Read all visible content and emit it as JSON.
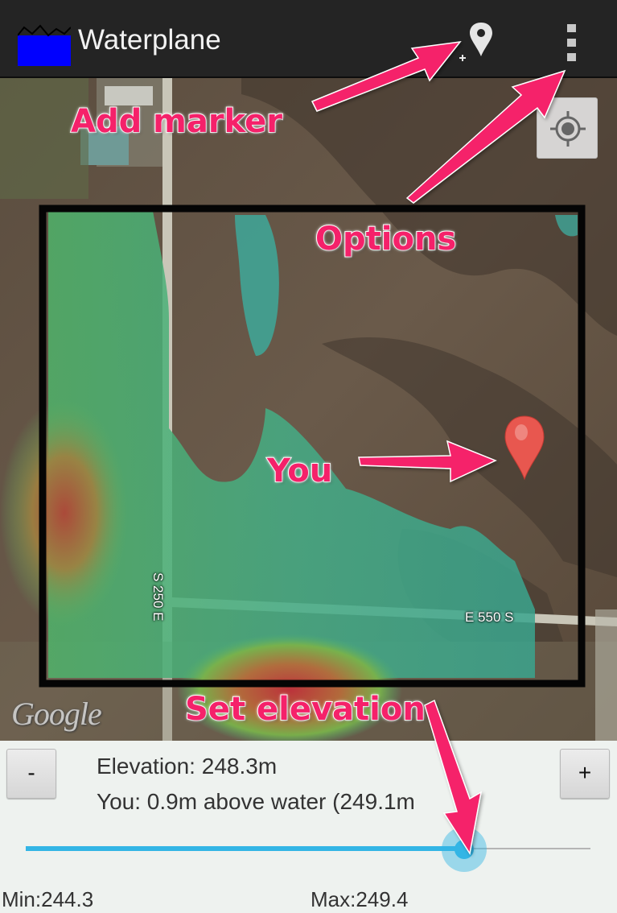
{
  "app": {
    "title": "Waterplane",
    "icon_name": "waterplane-app-icon"
  },
  "actionbar": {
    "add_marker_icon": "add-marker-icon",
    "overflow_icon": "overflow-menu-icon"
  },
  "map": {
    "locate_icon": "my-location-icon",
    "road_labels": [
      "S 250 E",
      "E 550 S"
    ],
    "attribution": "Google",
    "user_marker_icon": "map-pin-icon"
  },
  "annotations": {
    "add_marker": "Add marker",
    "options": "Options",
    "you": "You",
    "set_elevation": "Set elevation",
    "color": "#f5216a"
  },
  "panel": {
    "minus_label": "-",
    "plus_label": "+",
    "elevation_text": "Elevation: 248.3m",
    "you_text": "You: 0.9m above water (249.1m",
    "min_text": "Min:244.3",
    "max_text": "Max:249.4",
    "slider_fraction": 0.777,
    "accent_color": "#33b5e5"
  }
}
